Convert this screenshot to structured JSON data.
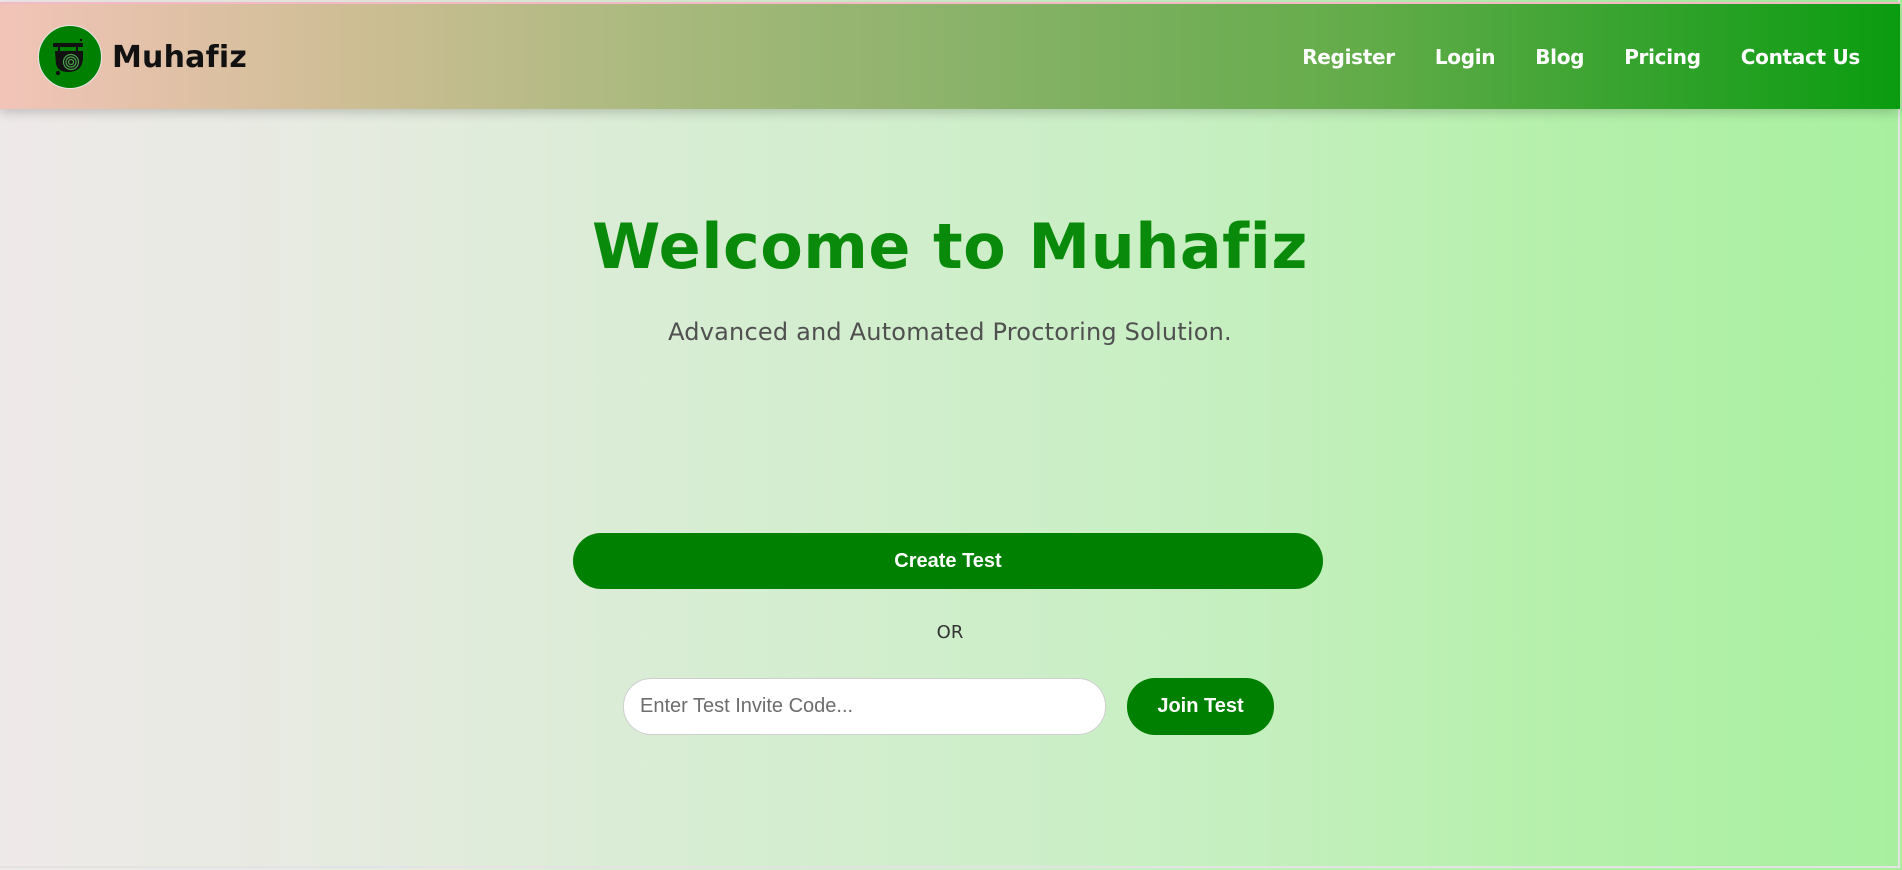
{
  "brand": {
    "name": "Muhafiz",
    "logo_icon": "security-camera-icon",
    "logo_bg": "#008000"
  },
  "nav": {
    "items": [
      {
        "label": "Register"
      },
      {
        "label": "Login"
      },
      {
        "label": "Blog"
      },
      {
        "label": "Pricing"
      },
      {
        "label": "Contact Us"
      }
    ]
  },
  "hero": {
    "title": "Welcome to Muhafiz",
    "subtitle": "Advanced and Automated Proctoring Solution."
  },
  "actions": {
    "create_label": "Create Test",
    "or_label": "OR",
    "invite_placeholder": "Enter Test Invite Code...",
    "invite_value": "",
    "join_label": "Join Test"
  },
  "colors": {
    "primary_green": "#008000",
    "title_green": "#0a8a0a"
  }
}
